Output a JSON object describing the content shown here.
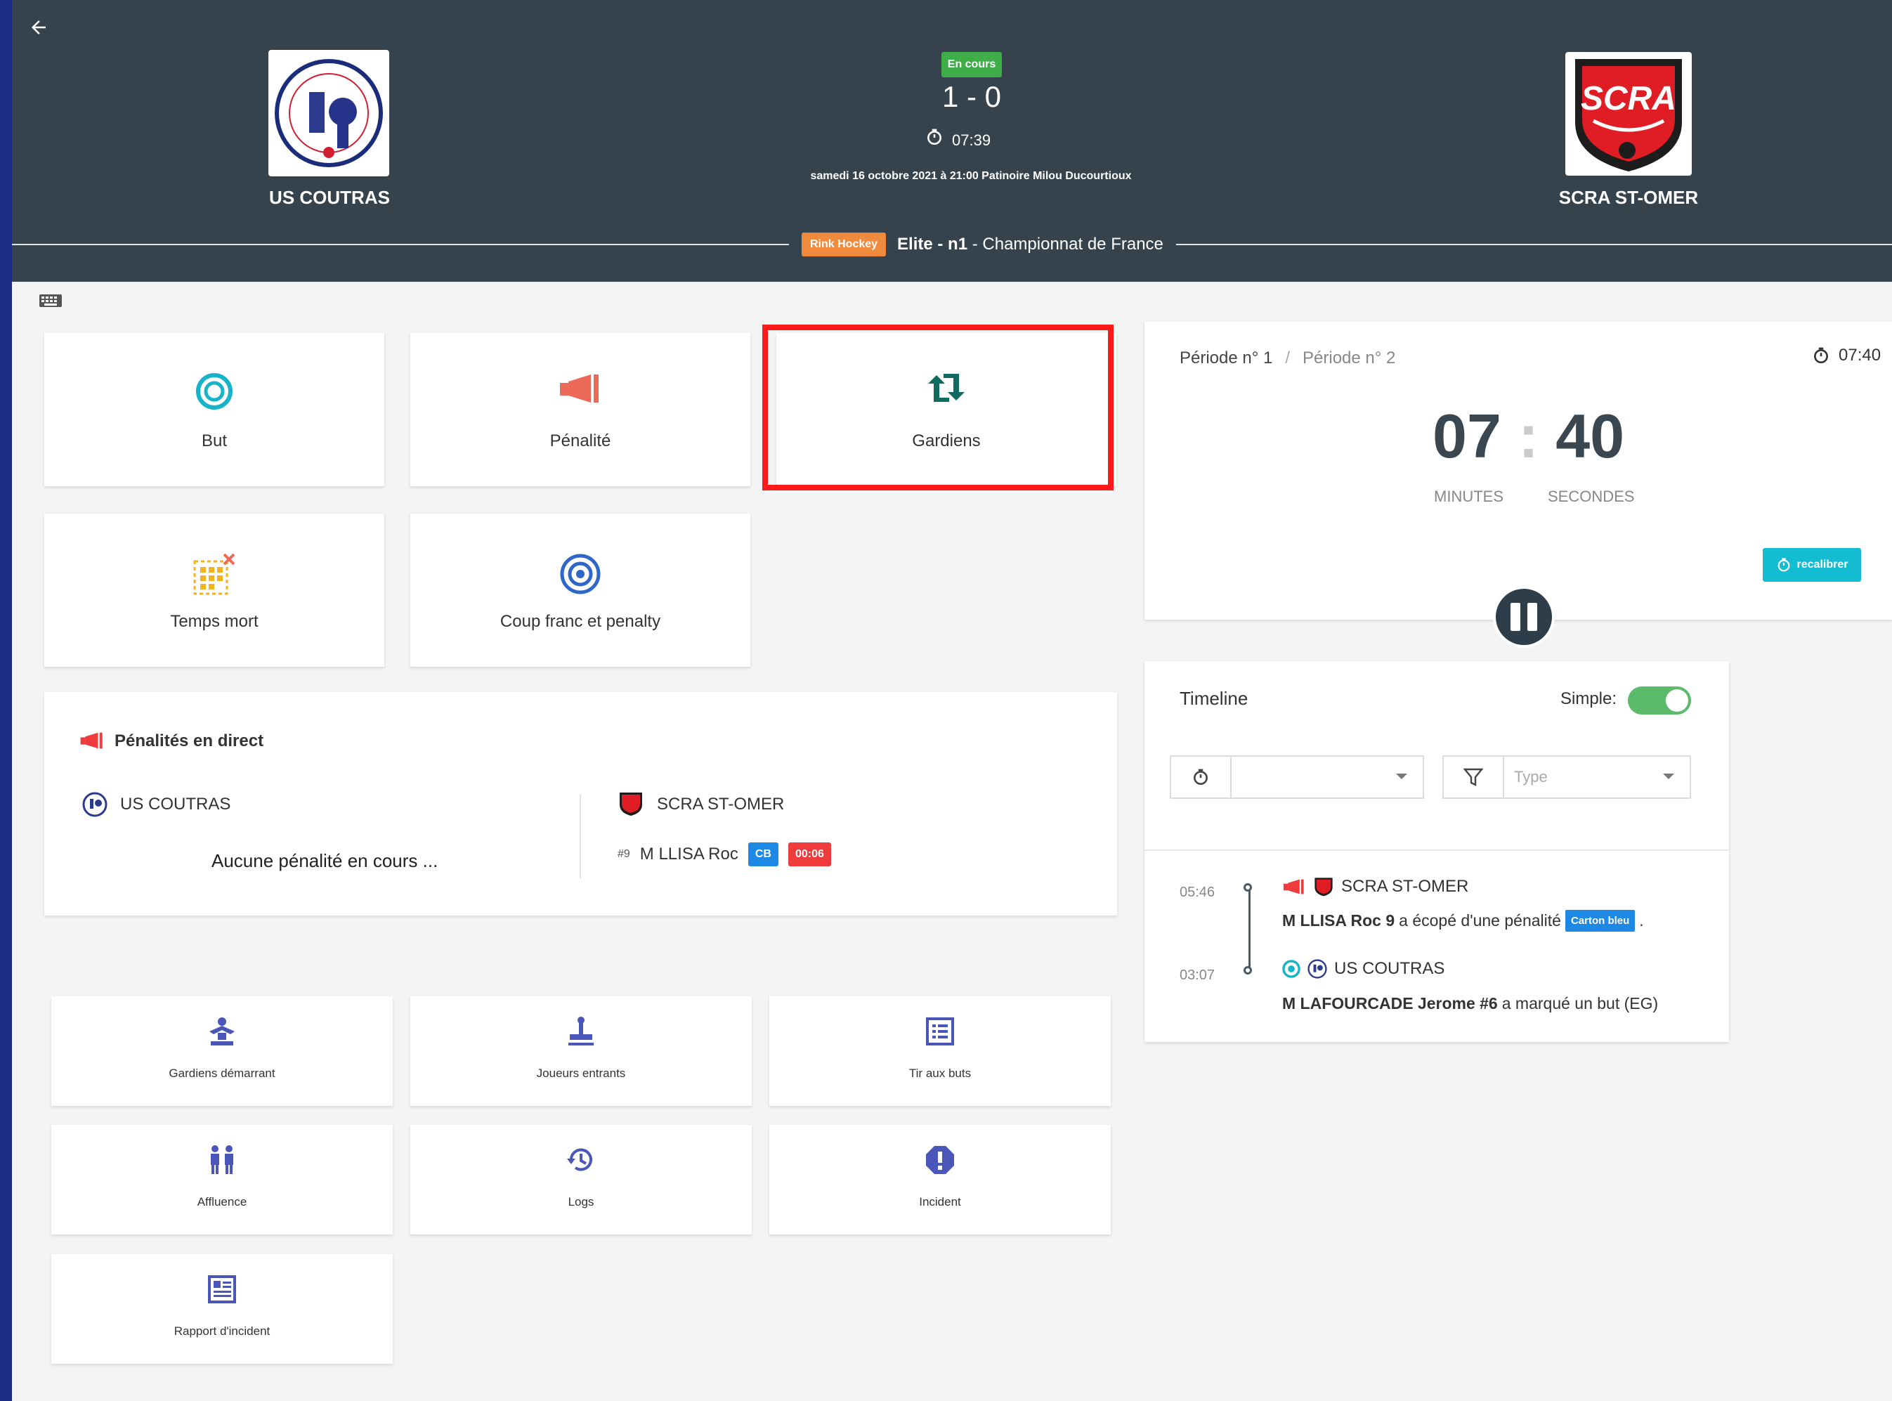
{
  "header": {
    "back_label": "←",
    "home_team": {
      "name": "US COUTRAS"
    },
    "away_team": {
      "name": "SCRA ST-OMER",
      "logo_text": "SCRA"
    },
    "status": "En cours",
    "score": "1 - 0",
    "chrono": "07:39",
    "match_info": "samedi 16 octobre 2021 à 21:00 Patinoire Milou Ducourtioux",
    "sport": "Rink Hockey",
    "competition_bold": "Elite - n1",
    "competition_rest": " - Championnat de France"
  },
  "actions": [
    {
      "label": "But",
      "icon": "target-icon"
    },
    {
      "label": "Pénalité",
      "icon": "megaphone-icon"
    },
    {
      "label": "Gardiens",
      "icon": "swap-icon"
    },
    {
      "label": "Temps mort",
      "icon": "timeout-grid-icon"
    },
    {
      "label": "Coup franc et penalty",
      "icon": "bullseye-icon"
    }
  ],
  "penalties": {
    "title": "Pénalités en direct",
    "home_team": "US COUTRAS",
    "home_empty": "Aucune pénalité en cours ...",
    "away_team": "SCRA ST-OMER",
    "rows": [
      {
        "number": "#9",
        "player": "M LLISA Roc",
        "card": "CB",
        "time": "00:06"
      }
    ]
  },
  "secondary_actions": [
    {
      "label": "Gardiens démarrant",
      "icon": "goalkeeper-icon"
    },
    {
      "label": "Joueurs entrants",
      "icon": "stamp-icon"
    },
    {
      "label": "Tir aux buts",
      "icon": "list-box-icon"
    },
    {
      "label": "Affluence",
      "icon": "people-icon"
    },
    {
      "label": "Logs",
      "icon": "history-icon"
    },
    {
      "label": "Incident",
      "icon": "alert-octagon-icon"
    },
    {
      "label": "Rapport d'incident",
      "icon": "report-icon"
    }
  ],
  "period": {
    "period1": "Période n° 1",
    "separator": "/",
    "period2": "Période n° 2",
    "elapsed": "07:40",
    "minutes": "07",
    "seconds": "40",
    "minutes_label": "MINUTES",
    "seconds_label": "SECONDES",
    "recal_label": "recalibrer"
  },
  "timeline": {
    "title": "Timeline",
    "simple_label": "Simple:",
    "simple_on": true,
    "filter_time_value": "",
    "filter_type_placeholder": "Type",
    "events": [
      {
        "time": "05:46",
        "team": "SCRA ST-OMER",
        "player": "M LLISA Roc 9",
        "text": " a écopé d'une pénalité ",
        "badge": "Carton bleu",
        "suffix": "."
      },
      {
        "time": "03:07",
        "team": "US COUTRAS",
        "player": "M LAFOURCADE Jerome #6",
        "text": " a marqué un but (EG)"
      }
    ]
  },
  "colors": {
    "header_bg": "#36434c",
    "status_green": "#3fae49",
    "sport_orange": "#f08a3c",
    "penalty_red": "#ef3b3b",
    "card_blue": "#1e88e5",
    "recal_cyan": "#14bcd2",
    "toggle_green": "#5cbb6b",
    "highlight_red": "#ff1a1a",
    "icon_teal": "#17b3c9",
    "icon_indigo": "#4a56b8",
    "icon_dark_teal": "#0f6b5e"
  }
}
